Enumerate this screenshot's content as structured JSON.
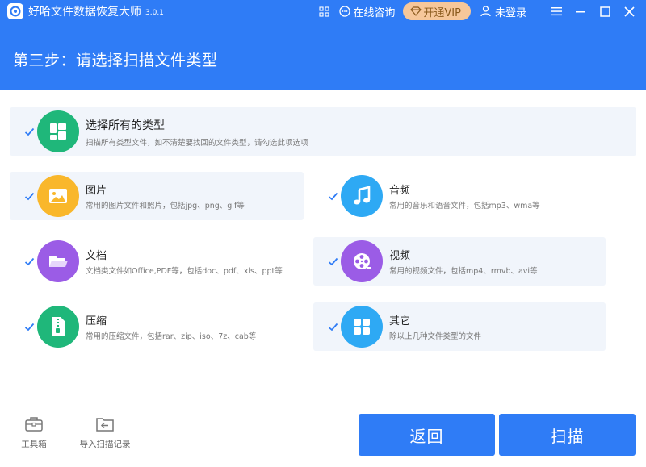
{
  "app": {
    "title": "好哈文件数据恢复大师",
    "version": "3.0.1",
    "consult_label": "在线咨询",
    "vip_label": "开通VIP",
    "login_label": "未登录"
  },
  "header": {
    "step_title": "第三步：请选择扫描文件类型"
  },
  "all_types": {
    "title": "选择所有的类型",
    "desc": "扫描所有类型文件，如不清楚要找回的文件类型，请勾选此项选项",
    "checked": true
  },
  "types": [
    {
      "key": "image",
      "title": "图片",
      "desc": "常用的图片文件和照片，包括jpg、png、gif等",
      "color": "#f9b72b",
      "icon": "image-icon",
      "checked": true
    },
    {
      "key": "audio",
      "title": "音频",
      "desc": "常用的音乐和语音文件，包括mp3、wma等",
      "color": "#2ea9f4",
      "icon": "music-note-icon",
      "checked": true
    },
    {
      "key": "document",
      "title": "文档",
      "desc": "文档类文件如Office,PDF等，包括doc、pdf、xls、ppt等",
      "color": "#9b5ce6",
      "icon": "folder-icon",
      "checked": true
    },
    {
      "key": "video",
      "title": "视频",
      "desc": "常用的视频文件，包括mp4、rmvb、avi等",
      "color": "#9b5ce6",
      "icon": "film-reel-icon",
      "checked": true
    },
    {
      "key": "archive",
      "title": "压缩",
      "desc": "常用的压缩文件，包括rar、zip、iso、7z、cab等",
      "color": "#1fb77a",
      "icon": "zip-file-icon",
      "checked": true
    },
    {
      "key": "other",
      "title": "其它",
      "desc": "除以上几种文件类型的文件",
      "color": "#2ea9f4",
      "icon": "tiles-icon",
      "checked": true
    }
  ],
  "footer": {
    "toolbox_label": "工具箱",
    "import_label": "导入扫描记录",
    "back_label": "返回",
    "scan_label": "扫描"
  },
  "colors": {
    "primary": "#2f7cf6",
    "check": "#2f7cf6",
    "all_types_icon": "#1fb77a",
    "vip_bg": "#f6c79a"
  }
}
